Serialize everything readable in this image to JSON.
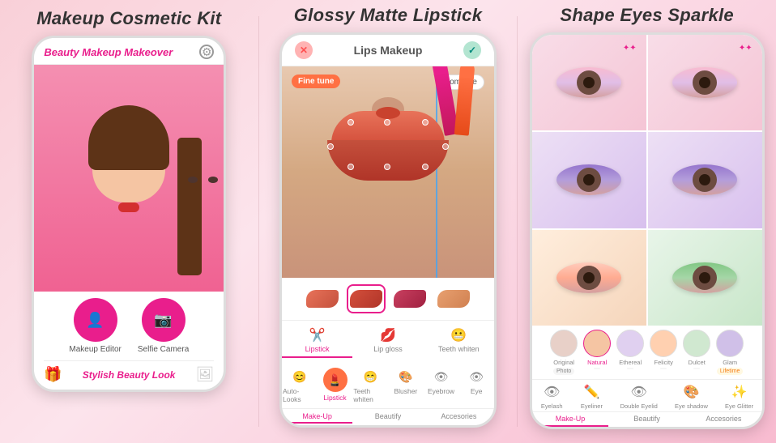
{
  "panels": [
    {
      "title": "Makeup Cosmetic Kit",
      "phone": {
        "header_title": "Beauty Makeup Makeover",
        "buttons": [
          {
            "label": "Makeup Editor"
          },
          {
            "label": "Selfie Camera"
          }
        ],
        "footer_label": "Stylish Beauty Look"
      }
    },
    {
      "title": "Glossy Matte Lipstick",
      "phone": {
        "header_title": "Lips Makeup",
        "fine_tune": "Fine tune",
        "compare": "Compare",
        "swatches": [
          {
            "color": "#e8735a",
            "active": false
          },
          {
            "color": "#d4503c",
            "active": true
          },
          {
            "color": "#c94060",
            "active": false
          },
          {
            "color": "#e8a070",
            "active": false
          }
        ],
        "tabs1": [
          {
            "label": "Lipstick",
            "icon": "✂",
            "active": true
          },
          {
            "label": "Lip gloss",
            "icon": "💋",
            "active": false
          },
          {
            "label": "Teeth whiten",
            "icon": "😁",
            "active": false
          }
        ],
        "tabs2": [
          {
            "label": "Auto-Looks",
            "icon": "😊",
            "active": false
          },
          {
            "label": "Lipstick",
            "icon": "💄",
            "active": true
          },
          {
            "label": "Teeth whiten",
            "icon": "😁",
            "active": false
          },
          {
            "label": "Blusher",
            "icon": "🎨",
            "active": false
          },
          {
            "label": "Eyebrow",
            "icon": "👁",
            "active": false
          },
          {
            "label": "Eye",
            "icon": "👁",
            "active": false
          }
        ],
        "sections": [
          {
            "label": "Make-Up",
            "active": true
          },
          {
            "label": "Beautify",
            "active": false
          },
          {
            "label": "Accesories",
            "active": false
          }
        ]
      }
    },
    {
      "title": "Shape Eyes Sparkle",
      "phone": {
        "eye_styles": [
          {
            "shadow": "glitter",
            "sparkle": true
          },
          {
            "shadow": "glitter",
            "sparkle": true
          },
          {
            "shadow": "purple",
            "sparkle": false
          },
          {
            "shadow": "purple",
            "sparkle": false
          },
          {
            "shadow": "natural",
            "sparkle": false
          },
          {
            "shadow": "green",
            "sparkle": false
          }
        ],
        "looks": [
          {
            "label": "Original",
            "active": false
          },
          {
            "label": "Natural",
            "active": true
          },
          {
            "label": "Ethereal",
            "active": false
          },
          {
            "label": "Felicity",
            "active": false
          },
          {
            "label": "Dulcet",
            "active": false
          },
          {
            "label": "Glam",
            "active": false
          }
        ],
        "badges": [
          {
            "text": "Photo",
            "type": "normal"
          },
          {
            "text": "",
            "type": "normal"
          },
          {
            "text": "",
            "type": "normal"
          },
          {
            "text": "",
            "type": "normal"
          },
          {
            "text": "",
            "type": "normal"
          },
          {
            "text": "Lifetime",
            "type": "gold"
          }
        ],
        "icons": [
          {
            "label": "Eyelash",
            "icon": "👁",
            "active": false
          },
          {
            "label": "Eyeliner",
            "icon": "✏",
            "active": false
          },
          {
            "label": "Double Eyelid",
            "icon": "👁",
            "active": false
          },
          {
            "label": "Eye shadow",
            "icon": "🎨",
            "active": false
          },
          {
            "label": "Eye Glitter",
            "icon": "✨",
            "active": false
          }
        ],
        "sections": [
          {
            "label": "Make-Up",
            "active": true
          },
          {
            "label": "Beautify",
            "active": false
          },
          {
            "label": "Accesories",
            "active": false
          }
        ]
      }
    }
  ]
}
